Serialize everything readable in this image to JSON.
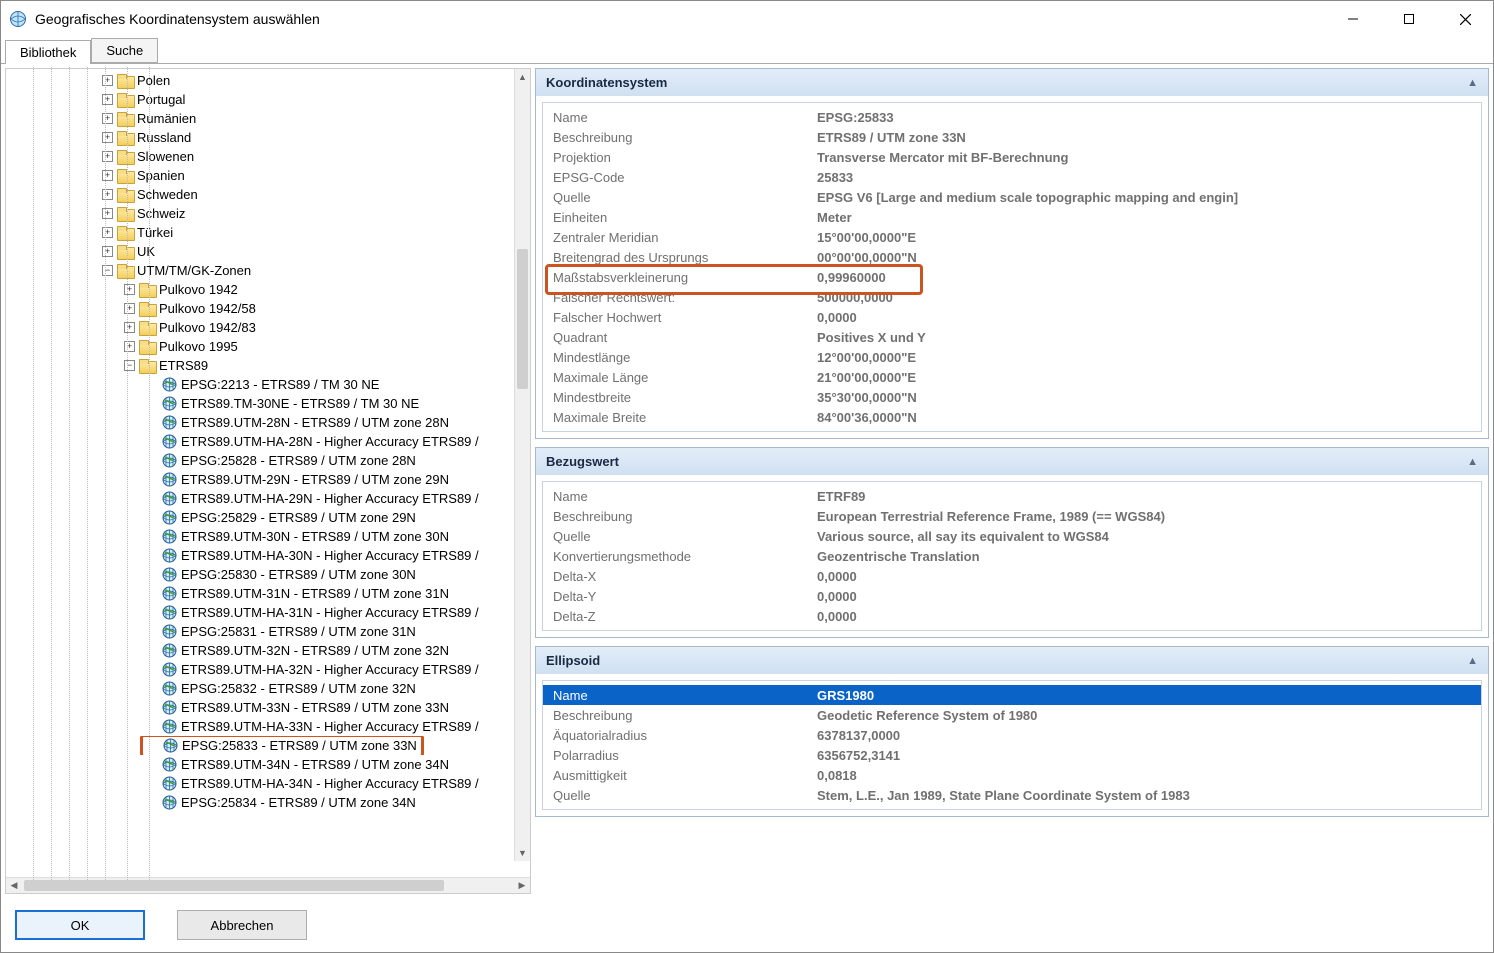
{
  "window": {
    "title": "Geografisches Koordinatensystem auswählen"
  },
  "tabs": {
    "library": "Bibliothek",
    "search": "Suche"
  },
  "tree": {
    "countries": [
      "Polen",
      "Portugal",
      "Rumänien",
      "Russland",
      "Slowenen",
      "Spanien",
      "Schweden",
      "Schweiz",
      "Türkei",
      "UK"
    ],
    "utm_root": "UTM/TM/GK-Zonen",
    "utm_folders": [
      "Pulkovo 1942",
      "Pulkovo 1942/58",
      "Pulkovo 1942/83",
      "Pulkovo 1995"
    ],
    "etrs_root": "ETRS89",
    "etrs_items": [
      "EPSG:2213 - ETRS89 / TM 30 NE",
      "ETRS89.TM-30NE - ETRS89 / TM 30 NE",
      "ETRS89.UTM-28N - ETRS89 / UTM zone 28N",
      "ETRS89.UTM-HA-28N - Higher Accuracy ETRS89 /",
      "EPSG:25828 - ETRS89 / UTM zone 28N",
      "ETRS89.UTM-29N - ETRS89 / UTM zone 29N",
      "ETRS89.UTM-HA-29N - Higher Accuracy ETRS89 /",
      "EPSG:25829 - ETRS89 / UTM zone 29N",
      "ETRS89.UTM-30N - ETRS89 / UTM zone 30N",
      "ETRS89.UTM-HA-30N - Higher Accuracy ETRS89 /",
      "EPSG:25830 - ETRS89 / UTM zone 30N",
      "ETRS89.UTM-31N - ETRS89 / UTM zone 31N",
      "ETRS89.UTM-HA-31N - Higher Accuracy ETRS89 /",
      "EPSG:25831 - ETRS89 / UTM zone 31N",
      "ETRS89.UTM-32N - ETRS89 / UTM zone 32N",
      "ETRS89.UTM-HA-32N - Higher Accuracy ETRS89 /",
      "EPSG:25832 - ETRS89 / UTM zone 32N",
      "ETRS89.UTM-33N - ETRS89 / UTM zone 33N",
      "ETRS89.UTM-HA-33N - Higher Accuracy ETRS89 /",
      "EPSG:25833 - ETRS89 / UTM zone 33N",
      "ETRS89.UTM-34N - ETRS89 / UTM zone 34N",
      "ETRS89.UTM-HA-34N - Higher Accuracy ETRS89 /",
      "EPSG:25834 - ETRS89 / UTM zone 34N"
    ],
    "highlighted_index": 19
  },
  "sections": {
    "coord": {
      "title": "Koordinatensystem",
      "rows": [
        {
          "k": "Name",
          "v": "EPSG:25833"
        },
        {
          "k": "Beschreibung",
          "v": "ETRS89 / UTM zone 33N"
        },
        {
          "k": "Projektion",
          "v": "Transverse Mercator mit BF-Berechnung"
        },
        {
          "k": "EPSG-Code",
          "v": "25833"
        },
        {
          "k": "Quelle",
          "v": "EPSG V6 [Large and medium scale topographic mapping and engin]"
        },
        {
          "k": "Einheiten",
          "v": "Meter"
        },
        {
          "k": "Zentraler Meridian",
          "v": "15°00'00,0000\"E"
        },
        {
          "k": "Breitengrad des Ursprungs",
          "v": "00°00'00,0000\"N"
        },
        {
          "k": "Maßstabsverkleinerung",
          "v": "0,99960000"
        },
        {
          "k": "Falscher Rechtswert:",
          "v": "500000,0000"
        },
        {
          "k": "Falscher Hochwert",
          "v": "0,0000"
        },
        {
          "k": "Quadrant",
          "v": "Positives X und Y"
        },
        {
          "k": "Mindestlänge",
          "v": "12°00'00,0000\"E"
        },
        {
          "k": "Maximale Länge",
          "v": "21°00'00,0000\"E"
        },
        {
          "k": "Mindestbreite",
          "v": "35°30'00,0000\"N"
        },
        {
          "k": "Maximale Breite",
          "v": "84°00'36,0000\"N"
        }
      ],
      "highlight_row_index": 8
    },
    "datum": {
      "title": "Bezugswert",
      "rows": [
        {
          "k": "Name",
          "v": "ETRF89"
        },
        {
          "k": "Beschreibung",
          "v": "European Terrestrial Reference Frame, 1989 (== WGS84)"
        },
        {
          "k": "Quelle",
          "v": "Various source, all say its equivalent to WGS84"
        },
        {
          "k": "Konvertierungsmethode",
          "v": "Geozentrische Translation"
        },
        {
          "k": "Delta-X",
          "v": "0,0000"
        },
        {
          "k": "Delta-Y",
          "v": "0,0000"
        },
        {
          "k": "Delta-Z",
          "v": "0,0000"
        }
      ]
    },
    "ellipsoid": {
      "title": "Ellipsoid",
      "rows": [
        {
          "k": "Name",
          "v": "GRS1980"
        },
        {
          "k": "Beschreibung",
          "v": "Geodetic Reference System of 1980"
        },
        {
          "k": "Äquatorialradius",
          "v": "6378137,0000"
        },
        {
          "k": "Polarradius",
          "v": "6356752,3141"
        },
        {
          "k": "Ausmittigkeit",
          "v": "0,0818"
        },
        {
          "k": "Quelle",
          "v": "Stem, L.E., Jan 1989, State Plane Coordinate System of 1983"
        }
      ],
      "selected_row_index": 0
    }
  },
  "buttons": {
    "ok": "OK",
    "cancel": "Abbrechen"
  }
}
